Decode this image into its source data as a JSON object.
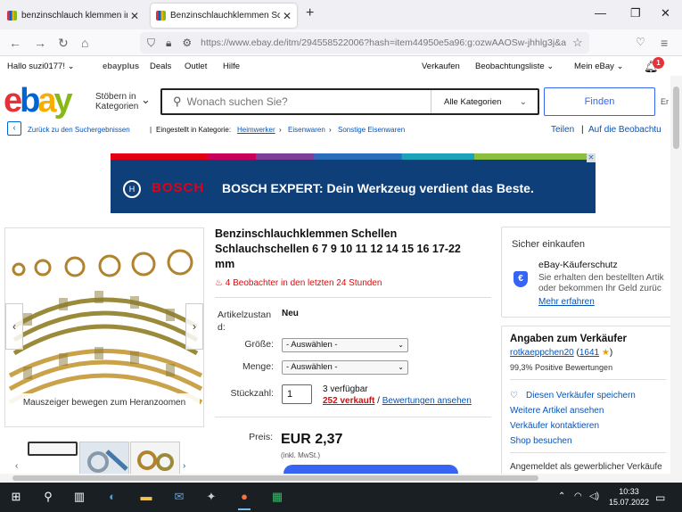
{
  "browser": {
    "tabs": [
      {
        "label": "benzinschlauch klemmen in | eB"
      },
      {
        "label": "Benzinschlauchklemmen Schelle"
      }
    ],
    "new_tab": "+",
    "url": "https://www.ebay.de/itm/294558522006?hash=item44950e5a96:g:ozwAAOSw-jhhlg3j&a"
  },
  "ebay_header": {
    "greeting": "Hallo suzi0177!",
    "ebayplus": "ebayplus",
    "links": [
      "Deals",
      "Outlet",
      "Hilfe"
    ],
    "right_links": [
      "Verkaufen",
      "Beobachtungsliste",
      "Mein eBay"
    ],
    "notification_count": "1"
  },
  "search": {
    "browse": [
      "Stöbern in",
      "Kategorien"
    ],
    "placeholder": "Wonach suchen Sie?",
    "category": "Alle Kategorien",
    "find_button": "Finden",
    "advanced": "Er"
  },
  "breadcrumb": {
    "back": "Zurück zu den Suchergebnissen",
    "listed_in": "Eingestellt in Kategorie:",
    "path": [
      "Heimwerker",
      "Eisenwaren",
      "Sonstige Eisenwaren"
    ],
    "share": "Teilen",
    "watch": "Auf die Beobachtu"
  },
  "ad_banner": {
    "brand": "BOSCH",
    "text": "BOSCH EXPERT: Dein Werkzeug verdient das Beste."
  },
  "gallery": {
    "hint": "Mauszeiger bewegen zum Heranzoomen"
  },
  "product": {
    "title": "Benzinschlauchklemmen Schellen Schlauchschellen 6 7 9 10 11 12 14 15 16 17-22 mm",
    "watchers": "4 Beobachter in den letzten 24 Stunden",
    "condition_label": "Artikelzustand:",
    "condition": "Neu",
    "size_label": "Größe:",
    "size_value": "- Auswählen -",
    "amount_label": "Menge:",
    "amount_value": "- Auswählen -",
    "qty_label": "Stückzahl:",
    "qty_value": "1",
    "available": "3 verfügbar",
    "sold": "252 verkauft",
    "sold_sep": "/",
    "reviews_link": "Bewertungen ansehen",
    "price_label": "Preis:",
    "price": "EUR 2,37",
    "vat": "(inkl. MwSt.)"
  },
  "safe_buy": {
    "heading": "Sicher einkaufen",
    "title": "eBay-Käuferschutz",
    "line1": "Sie erhalten den bestellten Artik",
    "line2": "oder bekommen Ihr Geld zurüc",
    "more": "Mehr erfahren"
  },
  "seller": {
    "heading": "Angaben zum Verkäufer",
    "name": "rotkaeppchen20",
    "score": "1641",
    "positive": "99,3% Positive Bewertungen",
    "save": "Diesen Verkäufer speichern",
    "more_items": "Weitere Artikel ansehen",
    "contact": "Verkäufer kontaktieren",
    "shop": "Shop besuchen",
    "business": "Angemeldet als gewerblicher Verkäufe"
  },
  "taskbar": {
    "time": "10:33",
    "date": "15.07.2022"
  }
}
